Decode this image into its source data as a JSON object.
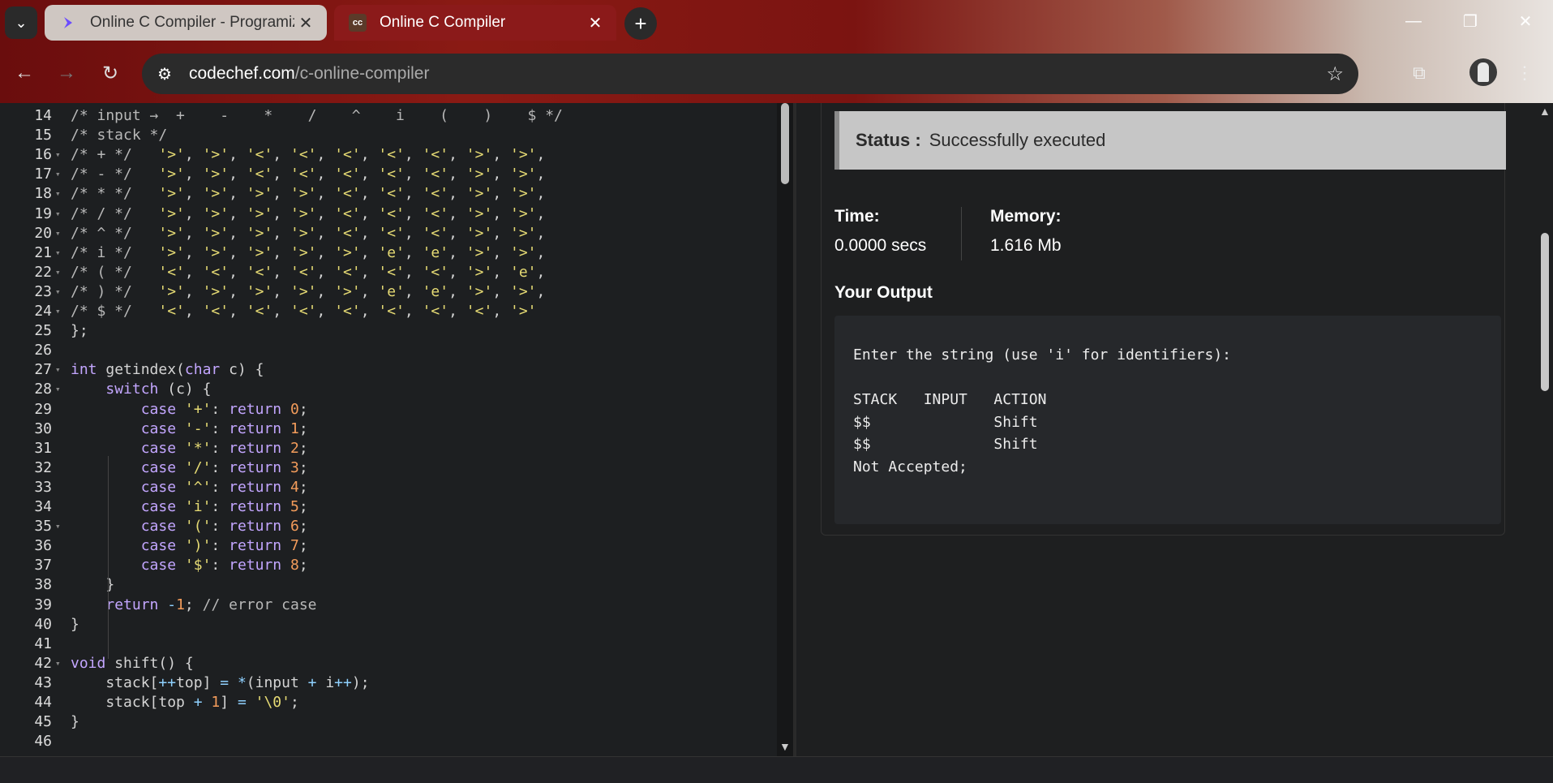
{
  "browser": {
    "tabs": [
      {
        "title": "Online C Compiler - Programiz",
        "favicon": "programiz-logo-icon"
      },
      {
        "title": "Online C Compiler",
        "favicon_text": "cc"
      }
    ],
    "url_domain": "codechef.com",
    "url_path": "/c-online-compiler"
  },
  "editor": {
    "lines": [
      {
        "n": "14",
        "fold": false,
        "html": "<span class='cm'>/* input →  +    -    *    /    ^    i    (    )    $ */</span>"
      },
      {
        "n": "15",
        "fold": false,
        "html": "<span class='cm'>/* stack */</span>"
      },
      {
        "n": "16",
        "fold": true,
        "html": "<span class='cm'>/* + */</span>   <span class='ch'>'&gt;'</span>, <span class='ch'>'&gt;'</span>, <span class='ch'>'&lt;'</span>, <span class='ch'>'&lt;'</span>, <span class='ch'>'&lt;'</span>, <span class='ch'>'&lt;'</span>, <span class='ch'>'&lt;'</span>, <span class='ch'>'&gt;'</span>, <span class='ch'>'&gt;'</span>,"
      },
      {
        "n": "17",
        "fold": true,
        "html": "<span class='cm'>/* - */</span>   <span class='ch'>'&gt;'</span>, <span class='ch'>'&gt;'</span>, <span class='ch'>'&lt;'</span>, <span class='ch'>'&lt;'</span>, <span class='ch'>'&lt;'</span>, <span class='ch'>'&lt;'</span>, <span class='ch'>'&lt;'</span>, <span class='ch'>'&gt;'</span>, <span class='ch'>'&gt;'</span>,"
      },
      {
        "n": "18",
        "fold": true,
        "html": "<span class='cm'>/* * */</span>   <span class='ch'>'&gt;'</span>, <span class='ch'>'&gt;'</span>, <span class='ch'>'&gt;'</span>, <span class='ch'>'&gt;'</span>, <span class='ch'>'&lt;'</span>, <span class='ch'>'&lt;'</span>, <span class='ch'>'&lt;'</span>, <span class='ch'>'&gt;'</span>, <span class='ch'>'&gt;'</span>,"
      },
      {
        "n": "19",
        "fold": true,
        "html": "<span class='cm'>/* / */</span>   <span class='ch'>'&gt;'</span>, <span class='ch'>'&gt;'</span>, <span class='ch'>'&gt;'</span>, <span class='ch'>'&gt;'</span>, <span class='ch'>'&lt;'</span>, <span class='ch'>'&lt;'</span>, <span class='ch'>'&lt;'</span>, <span class='ch'>'&gt;'</span>, <span class='ch'>'&gt;'</span>,"
      },
      {
        "n": "20",
        "fold": true,
        "html": "<span class='cm'>/* ^ */</span>   <span class='ch'>'&gt;'</span>, <span class='ch'>'&gt;'</span>, <span class='ch'>'&gt;'</span>, <span class='ch'>'&gt;'</span>, <span class='ch'>'&lt;'</span>, <span class='ch'>'&lt;'</span>, <span class='ch'>'&lt;'</span>, <span class='ch'>'&gt;'</span>, <span class='ch'>'&gt;'</span>,"
      },
      {
        "n": "21",
        "fold": true,
        "html": "<span class='cm'>/* i */</span>   <span class='ch'>'&gt;'</span>, <span class='ch'>'&gt;'</span>, <span class='ch'>'&gt;'</span>, <span class='ch'>'&gt;'</span>, <span class='ch'>'&gt;'</span>, <span class='ch'>'e'</span>, <span class='ch'>'e'</span>, <span class='ch'>'&gt;'</span>, <span class='ch'>'&gt;'</span>,"
      },
      {
        "n": "22",
        "fold": true,
        "html": "<span class='cm'>/* ( */</span>   <span class='ch'>'&lt;'</span>, <span class='ch'>'&lt;'</span>, <span class='ch'>'&lt;'</span>, <span class='ch'>'&lt;'</span>, <span class='ch'>'&lt;'</span>, <span class='ch'>'&lt;'</span>, <span class='ch'>'&lt;'</span>, <span class='ch'>'&gt;'</span>, <span class='ch'>'e'</span>,"
      },
      {
        "n": "23",
        "fold": true,
        "html": "<span class='cm'>/* ) */</span>   <span class='ch'>'&gt;'</span>, <span class='ch'>'&gt;'</span>, <span class='ch'>'&gt;'</span>, <span class='ch'>'&gt;'</span>, <span class='ch'>'&gt;'</span>, <span class='ch'>'e'</span>, <span class='ch'>'e'</span>, <span class='ch'>'&gt;'</span>, <span class='ch'>'&gt;'</span>,"
      },
      {
        "n": "24",
        "fold": true,
        "html": "<span class='cm'>/* $ */</span>   <span class='ch'>'&lt;'</span>, <span class='ch'>'&lt;'</span>, <span class='ch'>'&lt;'</span>, <span class='ch'>'&lt;'</span>, <span class='ch'>'&lt;'</span>, <span class='ch'>'&lt;'</span>, <span class='ch'>'&lt;'</span>, <span class='ch'>'&lt;'</span>, <span class='ch'>'&gt;'</span>"
      },
      {
        "n": "25",
        "fold": false,
        "html": "};"
      },
      {
        "n": "26",
        "fold": false,
        "html": ""
      },
      {
        "n": "27",
        "fold": true,
        "html": "<span class='kw'>int</span> getindex(<span class='kw'>char</span> c) {"
      },
      {
        "n": "28",
        "fold": true,
        "html": "    <span class='kw'>switch</span> (c) {"
      },
      {
        "n": "29",
        "fold": false,
        "html": "        <span class='kw'>case</span> <span class='ch'>'+'</span>: <span class='kw'>return</span> <span class='nm'>0</span>;"
      },
      {
        "n": "30",
        "fold": false,
        "html": "        <span class='kw'>case</span> <span class='ch'>'-'</span>: <span class='kw'>return</span> <span class='nm'>1</span>;"
      },
      {
        "n": "31",
        "fold": false,
        "html": "        <span class='kw'>case</span> <span class='ch'>'*'</span>: <span class='kw'>return</span> <span class='nm'>2</span>;"
      },
      {
        "n": "32",
        "fold": false,
        "html": "        <span class='kw'>case</span> <span class='ch'>'/'</span>: <span class='kw'>return</span> <span class='nm'>3</span>;"
      },
      {
        "n": "33",
        "fold": false,
        "html": "        <span class='kw'>case</span> <span class='ch'>'^'</span>: <span class='kw'>return</span> <span class='nm'>4</span>;"
      },
      {
        "n": "34",
        "fold": false,
        "html": "        <span class='kw'>case</span> <span class='ch'>'i'</span>: <span class='kw'>return</span> <span class='nm'>5</span>;"
      },
      {
        "n": "35",
        "fold": true,
        "html": "        <span class='kw'>case</span> <span class='ch'>'('</span>: <span class='kw'>return</span> <span class='nm'>6</span>;"
      },
      {
        "n": "36",
        "fold": false,
        "html": "        <span class='kw'>case</span> <span class='ch'>')'</span>: <span class='kw'>return</span> <span class='nm'>7</span>;"
      },
      {
        "n": "37",
        "fold": false,
        "html": "        <span class='kw'>case</span> <span class='ch'>'$'</span>: <span class='kw'>return</span> <span class='nm'>8</span>;"
      },
      {
        "n": "38",
        "fold": false,
        "html": "    }"
      },
      {
        "n": "39",
        "fold": false,
        "html": "    <span class='kw'>return</span> <span class='op'>-</span><span class='nm'>1</span>; <span class='cm'>// error case</span>"
      },
      {
        "n": "40",
        "fold": false,
        "html": "}"
      },
      {
        "n": "41",
        "fold": false,
        "html": ""
      },
      {
        "n": "42",
        "fold": true,
        "html": "<span class='kw'>void</span> shift() {"
      },
      {
        "n": "43",
        "fold": false,
        "html": "    stack[<span class='op'>++</span>top] <span class='op'>=</span> <span class='op'>*</span>(input <span class='op'>+</span> i<span class='op'>++</span>);"
      },
      {
        "n": "44",
        "fold": false,
        "html": "    stack[top <span class='op'>+</span> <span class='nm'>1</span>] <span class='op'>=</span> <span class='ch'>'\\0'</span>;"
      },
      {
        "n": "45",
        "fold": false,
        "html": "}"
      },
      {
        "n": "46",
        "fold": false,
        "html": ""
      }
    ]
  },
  "output": {
    "status_label": "Status :",
    "status_value": "Successfully executed",
    "time_label": "Time:",
    "time_value": "0.0000 secs",
    "memory_label": "Memory:",
    "memory_value": "1.616 Mb",
    "your_output_label": "Your Output",
    "lines": [
      "Enter the string (use 'i' for identifiers):",
      "",
      "STACK   INPUT   ACTION",
      "$$              Shift",
      "$$              Shift",
      "Not Accepted;"
    ]
  }
}
